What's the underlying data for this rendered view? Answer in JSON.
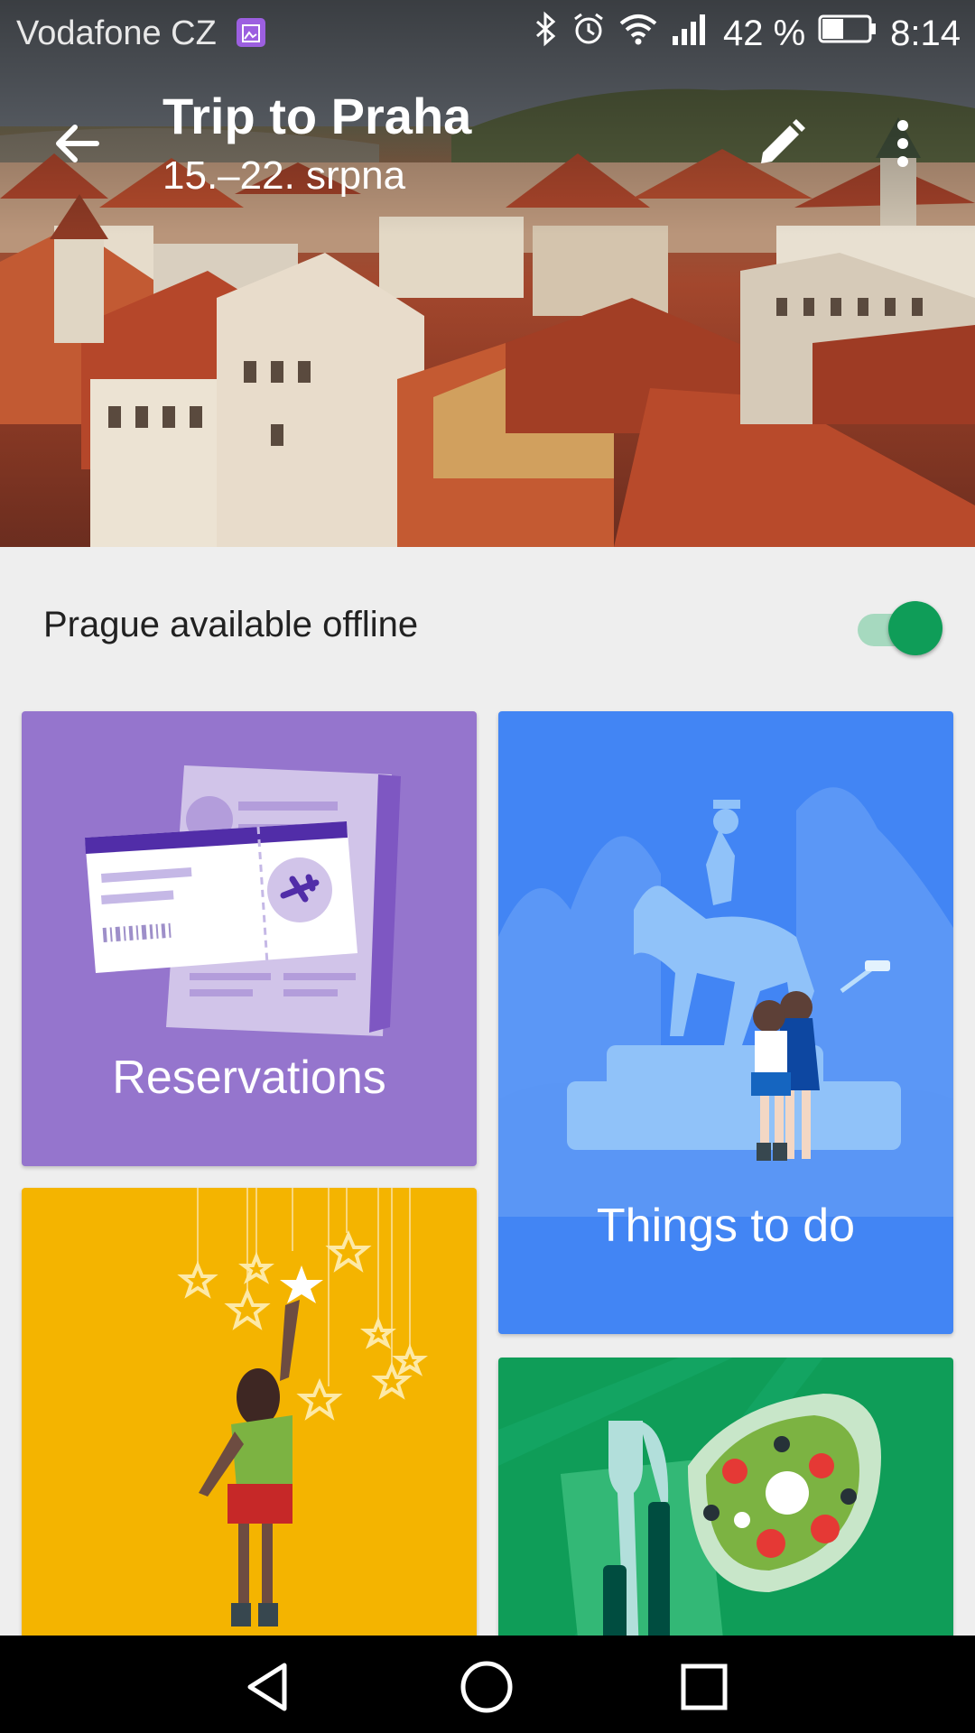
{
  "status_bar": {
    "carrier": "Vodafone CZ",
    "battery": "42 %",
    "time": "8:14",
    "icons": [
      "gallery-icon",
      "bluetooth-icon",
      "alarm-icon",
      "wifi-icon",
      "signal-icon",
      "battery-icon"
    ]
  },
  "app_bar": {
    "title": "Trip to Praha",
    "subtitle": "15.–22. srpna",
    "back_icon": "arrow-back-icon",
    "edit_icon": "pencil-icon",
    "more_icon": "more-vert-icon"
  },
  "offline": {
    "label": "Prague available offline",
    "enabled": true,
    "accent": "#0f9d58"
  },
  "cards": {
    "reservations": {
      "label": "Reservations",
      "color": "#9575cd"
    },
    "things_to_do": {
      "label": "Things to do",
      "color": "#4285f4"
    },
    "events": {
      "color": "#f4b400"
    },
    "food": {
      "color": "#0f9d58"
    }
  },
  "nav_bar": {
    "back": "nav-back-icon",
    "home": "nav-home-icon",
    "recents": "nav-recents-icon"
  }
}
